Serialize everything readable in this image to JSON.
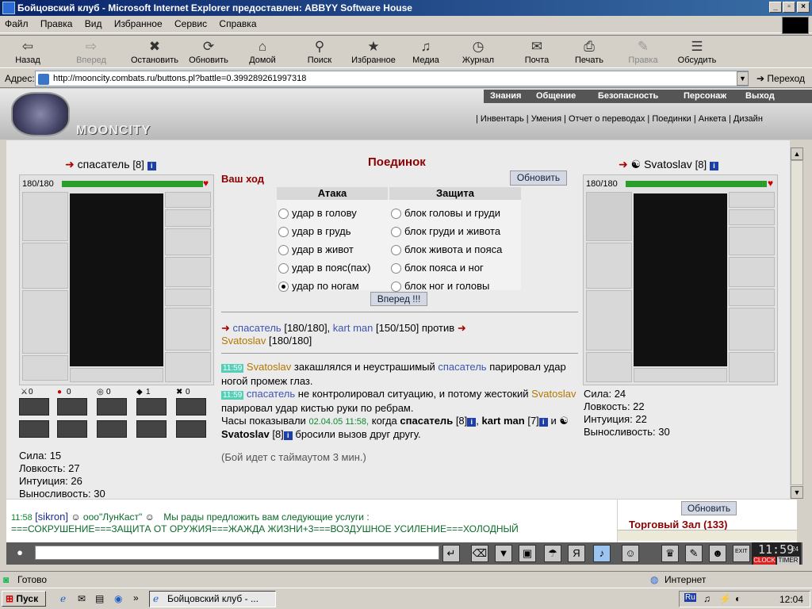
{
  "window": {
    "title": "Бойцовский клуб - Microsoft Internet Explorer предоставлен: ABBYY Software House"
  },
  "menu": [
    "Файл",
    "Правка",
    "Вид",
    "Избранное",
    "Сервис",
    "Справка"
  ],
  "toolbar": [
    {
      "label": "Назад",
      "icon": "back-arrow-icon",
      "glyph": "⇦",
      "enabled": true
    },
    {
      "label": "Вперед",
      "icon": "forward-arrow-icon",
      "glyph": "⇨",
      "enabled": false
    },
    {
      "label": "Остановить",
      "icon": "stop-icon",
      "glyph": "✖",
      "enabled": true
    },
    {
      "label": "Обновить",
      "icon": "refresh-icon",
      "glyph": "⟳",
      "enabled": true
    },
    {
      "label": "Домой",
      "icon": "home-icon",
      "glyph": "⌂",
      "enabled": true
    },
    {
      "label": "Поиск",
      "icon": "search-icon",
      "glyph": "⚲",
      "enabled": true
    },
    {
      "label": "Избранное",
      "icon": "favorites-icon",
      "glyph": "★",
      "enabled": true
    },
    {
      "label": "Медиа",
      "icon": "media-icon",
      "glyph": "♫",
      "enabled": true
    },
    {
      "label": "Журнал",
      "icon": "history-icon",
      "glyph": "◷",
      "enabled": true
    },
    {
      "label": "Почта",
      "icon": "mail-icon",
      "glyph": "✉",
      "enabled": true
    },
    {
      "label": "Печать",
      "icon": "print-icon",
      "glyph": "⎙",
      "enabled": true
    },
    {
      "label": "Правка",
      "icon": "edit-icon",
      "glyph": "✎",
      "enabled": false
    },
    {
      "label": "Обсудить",
      "icon": "discuss-icon",
      "glyph": "☰",
      "enabled": true
    }
  ],
  "address": {
    "label": "Адрес:",
    "url": "http://mooncity.combats.ru/buttons.pl?battle=0.399289261997318",
    "go": "Переход"
  },
  "site": {
    "logo_text": "MOONCITY",
    "nav_top": [
      "Знания",
      "Общение",
      "Безопасность",
      "Персонаж",
      "Выход"
    ],
    "nav_sub": [
      "Инвентарь",
      "Умения",
      "Отчет о переводах",
      "Поединки",
      "Анкета",
      "Дизайн"
    ]
  },
  "left_player": {
    "name": "спасатель",
    "level": "[8]",
    "hp": "180/180",
    "hp_fraction": 1.0,
    "counters": [
      "0",
      "0",
      "0",
      "1",
      "0"
    ],
    "stats": [
      "Сила: 15",
      "Ловкость: 27",
      "Интуиция: 26",
      "Выносливость: 30"
    ]
  },
  "right_player": {
    "name": "Svatoslav",
    "level": "[8]",
    "hp": "180/180",
    "hp_fraction": 1.0,
    "stats": [
      "Сила: 24",
      "Ловкость: 22",
      "Интуиция: 22",
      "Выносливость: 30"
    ]
  },
  "battle": {
    "title": "Поединок",
    "your_turn": "Ваш ход",
    "refresh": "Обновить",
    "attack_header": "Атака",
    "defense_header": "Защита",
    "attacks": [
      "удар в голову",
      "удар в грудь",
      "удар в живот",
      "удар в пояс(пах)",
      "удар по ногам"
    ],
    "attack_selected": 4,
    "defenses": [
      "блок головы и груди",
      "блок груди и живота",
      "блок живота и пояса",
      "блок пояса и ног",
      "блок ног и головы"
    ],
    "forward": "Вперед !!!",
    "versus": {
      "p1": "спасатель",
      "p1hp": "[180/180],",
      "p2": "kart man",
      "p2hp": "[150/150]",
      "word": "против",
      "p3": "Svatoslav",
      "p3hp": "[180/180]"
    },
    "log": {
      "t1": "11:59",
      "n1": "Svatoslav",
      "m1a": "закашлялся и неустрашимый",
      "n2": "спасатель",
      "m1b": "парировал удар ногой промеж глаз.",
      "t2": "11:59",
      "n3": "спасатель",
      "m2a": "не контролировал ситуацию, и потому жестокий",
      "n4": "Svatoslav",
      "m2b": "парировал удар кистью руки по ребрам.",
      "m3a": "Часы показывали",
      "ts": "02.04.05 11:58,",
      "m3b": "когда",
      "n5": "спасатель",
      "l5": "[8]",
      "n6": "kart man",
      "l6": "[7]",
      "m3c": "и",
      "n7": "Svatoslav",
      "l7": "[8]",
      "m3d": "бросили вызов друг другу."
    },
    "timeout": "(Бой идет с таймаутом 3 мин.)"
  },
  "chat": {
    "time": "11:58",
    "user": "[sikron]",
    "company": "ооо\"ЛунКаст\"",
    "msg": "Мы рады предложить вам следующие услуги :",
    "line2": "===СОКРУШЕНИЕ===ЗАЩИТА ОТ ОРУЖИЯ===ЖАЖДА ЖИЗНИ+3===ВОЗДУШНОЕ УСИЛЕНИЕ===ХОЛОДНЫЙ"
  },
  "trade": {
    "refresh": "Обновить",
    "room": "Торговый Зал (133)"
  },
  "clock_widget": {
    "time": "11:59",
    "sec": "24",
    "label1": "CLOCK",
    "label2": "TIMER",
    "exit": "EXIT"
  },
  "status": {
    "ready": "Готово",
    "zone": "Интернет"
  },
  "taskbar": {
    "start": "Пуск",
    "task": "Бойцовский клуб - ...",
    "time": "12:04",
    "lang": "Ru"
  }
}
